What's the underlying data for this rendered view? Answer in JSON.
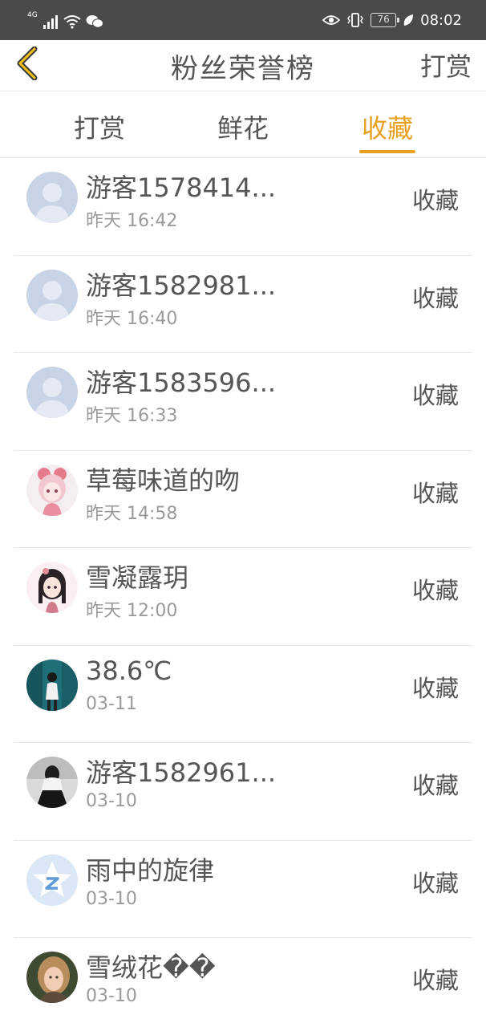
{
  "status_bar": {
    "network": "4G",
    "battery": "76",
    "time": "08:02"
  },
  "header": {
    "title": "粉丝荣誉榜",
    "action": "打赏"
  },
  "tabs": [
    {
      "label": "打赏",
      "active": false
    },
    {
      "label": "鲜花",
      "active": false
    },
    {
      "label": "收藏",
      "active": true
    }
  ],
  "colors": {
    "accent": "#e8a021",
    "status_bar": "#4a4a4a"
  },
  "fans": [
    {
      "name": "游客1578414...",
      "time": "昨天 16:42",
      "action": "收藏",
      "avatar": "default-person"
    },
    {
      "name": "游客1582981...",
      "time": "昨天 16:40",
      "action": "收藏",
      "avatar": "default-person"
    },
    {
      "name": "游客1583596...",
      "time": "昨天 16:33",
      "action": "收藏",
      "avatar": "default-person"
    },
    {
      "name": "草莓味道的吻",
      "time": "昨天 14:58",
      "action": "收藏",
      "avatar": "anime-girl-pink"
    },
    {
      "name": "雪凝露玥",
      "time": "昨天 12:00",
      "action": "收藏",
      "avatar": "anime-girl-dark-hair"
    },
    {
      "name": "38.6℃",
      "time": "03-11",
      "action": "收藏",
      "avatar": "photo-teal-street"
    },
    {
      "name": "游客1582961...",
      "time": "03-10",
      "action": "收藏",
      "avatar": "photo-schoolgirl"
    },
    {
      "name": "雨中的旋律",
      "time": "03-10",
      "action": "收藏",
      "avatar": "qq-star"
    },
    {
      "name": "雪绒花��",
      "time": "03-10",
      "action": "收藏",
      "avatar": "photo-girl-portrait"
    }
  ]
}
